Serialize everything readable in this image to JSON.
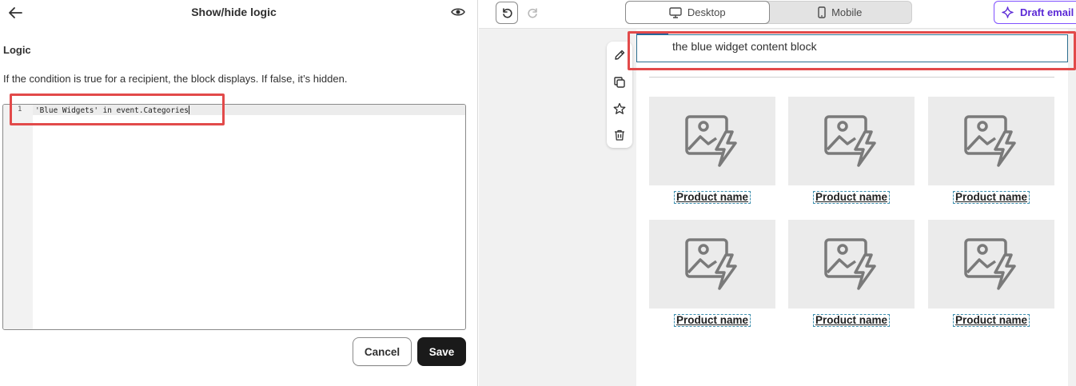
{
  "panel": {
    "title": "Show/hide logic",
    "section_label": "Logic",
    "help_text": "If the condition is true for a recipient, the block displays. If false, it’s hidden.",
    "editor": {
      "line_number": "1",
      "code": "'Blue Widgets' in event.Categories"
    },
    "cancel_label": "Cancel",
    "save_label": "Save"
  },
  "toolbar": {
    "views": [
      {
        "label": "Desktop",
        "icon": "monitor-icon",
        "active": true
      },
      {
        "label": "Mobile",
        "icon": "phone-icon",
        "active": false
      }
    ],
    "draft_label": "Draft email c"
  },
  "preview": {
    "text_block": "the blue widget content block",
    "products": [
      "Product name",
      "Product name",
      "Product name",
      "Product name",
      "Product name",
      "Product name"
    ]
  },
  "colors": {
    "highlight": "#e24a4a",
    "accent": "#8051ff",
    "primary_button": "#1a1a1a"
  }
}
